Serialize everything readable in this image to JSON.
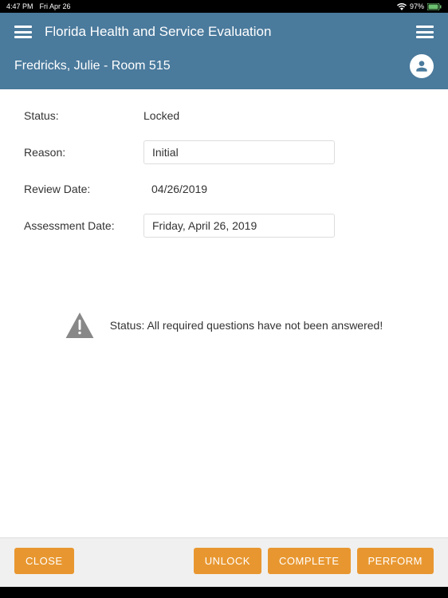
{
  "statusbar": {
    "time": "4:47 PM",
    "date": "Fri Apr 26",
    "battery": "97%"
  },
  "header": {
    "title": "Florida Health and Service Evaluation",
    "patient": "Fredricks, Julie - Room 515"
  },
  "form": {
    "status_label": "Status:",
    "status_value": "Locked",
    "reason_label": "Reason:",
    "reason_value": "Initial",
    "review_label": "Review Date:",
    "review_value": "04/26/2019",
    "assessment_label": "Assessment Date:",
    "assessment_value": "Friday, April 26, 2019"
  },
  "warning": {
    "text": "Status: All required questions have not been answered!"
  },
  "footer": {
    "close": "CLOSE",
    "unlock": "UNLOCK",
    "complete": "COMPLETE",
    "perform": "PERFORM"
  }
}
